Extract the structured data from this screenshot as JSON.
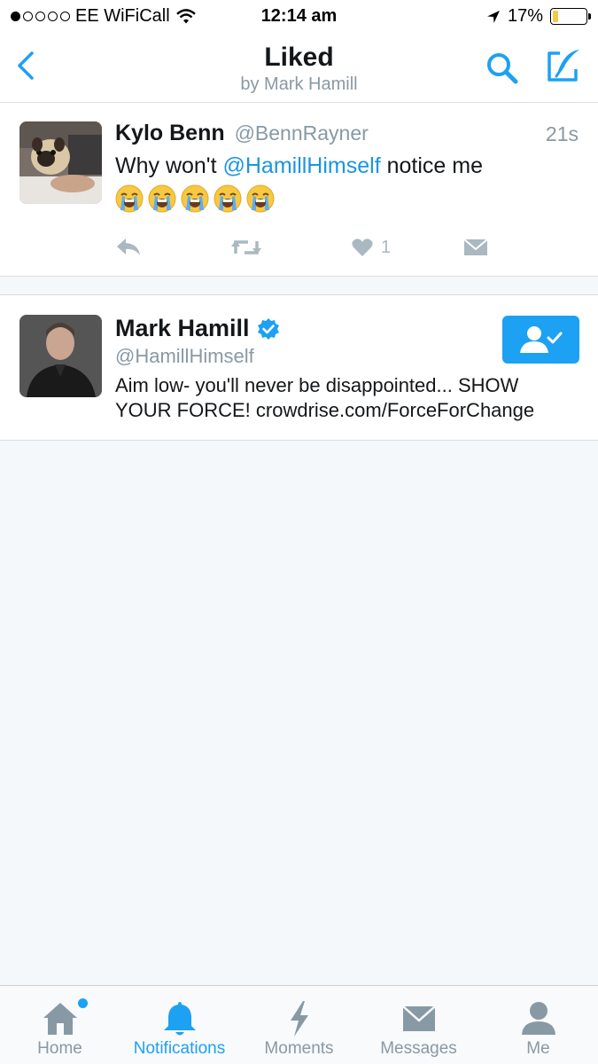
{
  "status_bar": {
    "carrier": "EE WiFiCall",
    "time": "12:14 am",
    "battery": "17%",
    "battery_level": 0.17
  },
  "nav": {
    "title": "Liked",
    "subtitle": "by Mark Hamill",
    "back_icon": "chevron-left-icon",
    "search_icon": "search-icon",
    "compose_icon": "compose-tweet-icon"
  },
  "tweet": {
    "name": "Kylo Benn",
    "handle": "@BennRayner",
    "time": "21s",
    "text_before": "Why won't ",
    "mention": "@HamillHimself",
    "text_after": " notice me",
    "emoji": [
      "loudly-crying-face",
      "loudly-crying-face",
      "loudly-crying-face",
      "loudly-crying-face",
      "loudly-crying-face"
    ],
    "like_count": "1"
  },
  "user": {
    "name": "Mark Hamill",
    "handle": "@HamillHimself",
    "bio": "Aim low- you'll never be disappointed... SHOW YOUR FORCE! crowdrise.com/ForceForChange",
    "verified": true,
    "following": true
  },
  "tabs": [
    {
      "label": "Home",
      "icon": "home-icon"
    },
    {
      "label": "Notifications",
      "icon": "bell-icon"
    },
    {
      "label": "Moments",
      "icon": "lightning-icon"
    },
    {
      "label": "Messages",
      "icon": "envelope-icon"
    },
    {
      "label": "Me",
      "icon": "person-icon"
    }
  ],
  "colors": {
    "accent": "#1da1f2",
    "link": "#1b95e0",
    "muted": "#8899a6",
    "battery": "#f2c94c"
  }
}
